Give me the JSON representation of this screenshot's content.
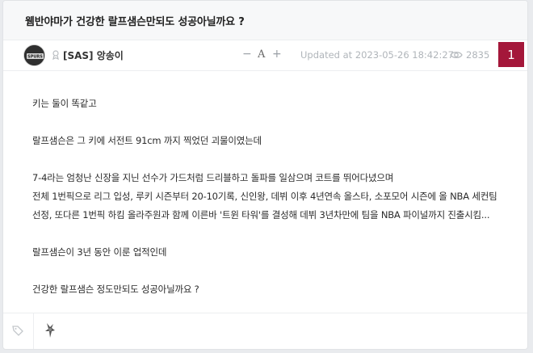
{
  "post": {
    "title": "웸반야마가 건강한 랄프샘슨만되도 성공아닐까요 ?",
    "author": "[SAS] 앙송이",
    "updated": "Updated at 2023-05-26 18:42:27",
    "views": "2835",
    "comment_count": "1",
    "font_controls": {
      "minus": "−",
      "a": "A",
      "plus": "+"
    },
    "body": [
      "키는 둘이 똑같고",
      "",
      "랄프샘슨은 그 키에 서전트 91cm 까지 찍었던 괴물이였는데",
      "",
      "7-4라는 엄청난 신장을 지닌 선수가 가드처럼 드리블하고 돌파를 일삼으며 코트를 뛰어다녔으며",
      "전체 1번픽으로 리그 입성, 루키 시즌부터 20-10기록, 신인왕, 데뷔 이후 4년연속 올스타, 소포모어 시즌에 올 NBA 세컨팀",
      "선정, 또다른 1번픽 하킴 올라주원과 함께 이른바 '트윈 타워'를 결성해 데뷔 3년차만에 팀을 NBA 파이널까지 진출시킴...",
      "",
      "랄프샘슨이 3년 동안 이룬 업적인데",
      "",
      "건강한 랄프샘슨 정도만되도 성공아닐까요 ?"
    ]
  },
  "icons": {
    "avatar": "spurs-logo-avatar",
    "level": "level-icon",
    "views": "eye-icon",
    "tag": "tag-icon",
    "team": "spurs-logo-icon"
  },
  "colors": {
    "accent": "#a4173a",
    "muted": "#b0b5ba"
  }
}
